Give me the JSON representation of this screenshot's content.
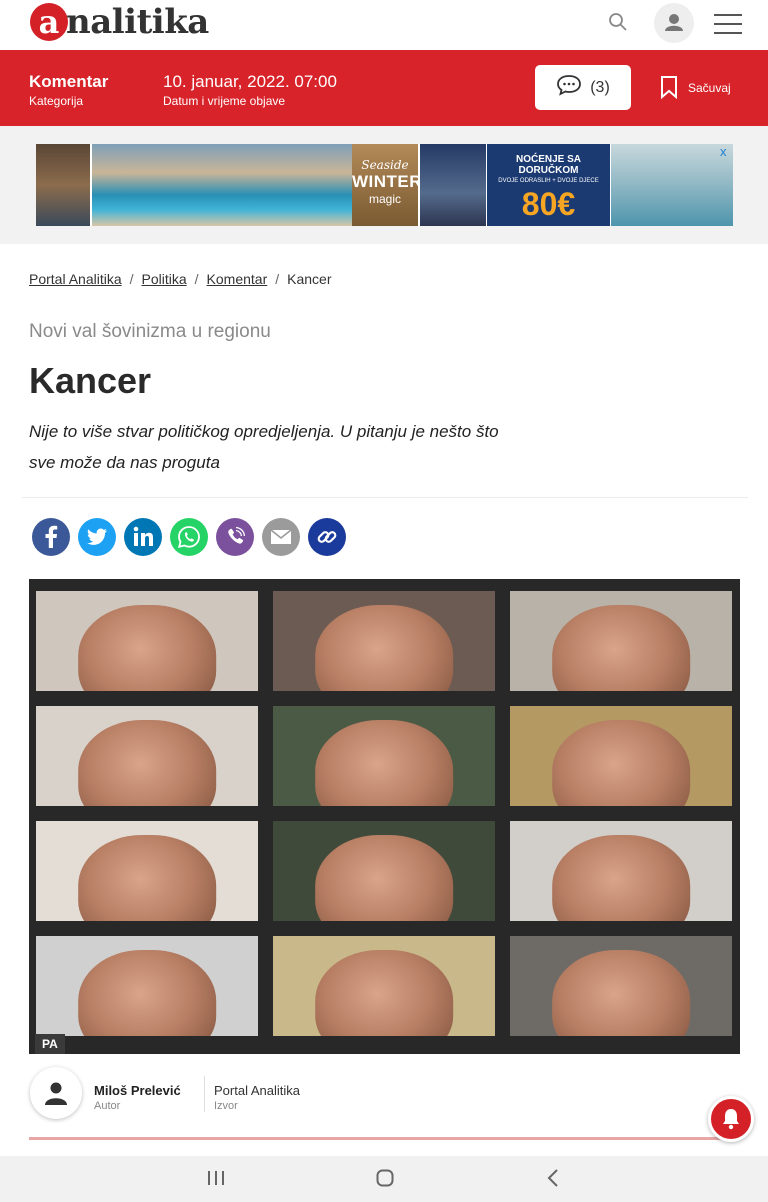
{
  "header": {
    "logo_letter": "a",
    "logo_text": "nalitika",
    "icons": [
      "search-icon",
      "user-icon",
      "hamburger-menu-icon"
    ]
  },
  "article_bar": {
    "category": "Komentar",
    "category_label": "Kategorija",
    "date": "10. januar, 2022. 07:00",
    "date_label": "Datum i vrijeme objave",
    "comments_count": "(3)",
    "save_label": "Sačuvaj",
    "accent_color": "#d8232a"
  },
  "ad": {
    "winter_script": "Seaside",
    "winter_title": "WINTER",
    "winter_sub": "magic",
    "offer_title": "NOĆENJE SA DORUČKOM",
    "offer_sub": "DVOJE ODRASLIH + DVOJE DJECE",
    "offer_price": "80€",
    "close_label": "x"
  },
  "breadcrumb": [
    {
      "label": "Portal Analitika"
    },
    {
      "label": "Politika"
    },
    {
      "label": "Komentar"
    },
    {
      "label": "Kancer"
    }
  ],
  "breadcrumb_sep": "/",
  "article": {
    "kicker": "Novi val šovinizma u regionu",
    "title": "Kancer",
    "lead": "Nije to više stvar političkog opredjeljenja. U pitanju je nešto što sve može da nas proguta"
  },
  "share": [
    {
      "name": "facebook-icon",
      "color": "#3b5998",
      "glyph": "f"
    },
    {
      "name": "twitter-icon",
      "color": "#1da1f2",
      "glyph": "t"
    },
    {
      "name": "linkedin-icon",
      "color": "#0077b5",
      "glyph": "in"
    },
    {
      "name": "whatsapp-icon",
      "color": "#25d366",
      "glyph": "w"
    },
    {
      "name": "viber-icon",
      "color": "#7b519d",
      "glyph": "v"
    },
    {
      "name": "email-icon",
      "color": "#9b9b9b",
      "glyph": "✉"
    },
    {
      "name": "copy-link-icon",
      "color": "#1b3b9c",
      "glyph": "🔗"
    }
  ],
  "photo": {
    "credit": "PA"
  },
  "author": {
    "name": "Miloš Prelević",
    "role": "Autor",
    "source": "Portal Analitika",
    "source_role": "Izvor"
  }
}
